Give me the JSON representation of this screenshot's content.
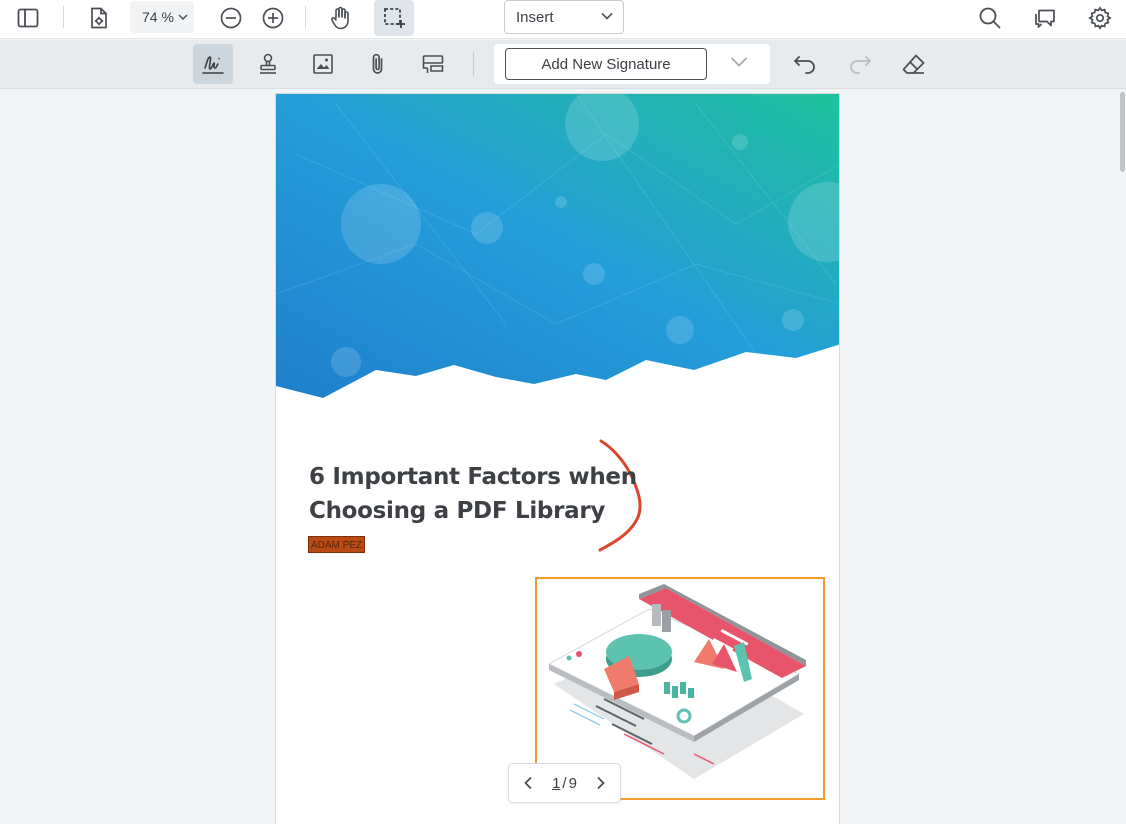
{
  "toolbar": {
    "zoom_level": "74 %",
    "mode": "Insert"
  },
  "signature_bar": {
    "add_signature_label": "Add New Signature"
  },
  "document": {
    "title_line1": "6 Important Factors when",
    "title_line2": "Choosing a PDF Library",
    "author": "ADAM PEZ"
  },
  "pagination": {
    "current_page": "1",
    "separator": "/",
    "total_pages": "9"
  },
  "colors": {
    "accent": "#f39a2c",
    "ink_annotation": "#d9462c",
    "author_highlight": "#b84a12",
    "hero_blue": "#1f86cf",
    "hero_teal": "#1fbf9e"
  }
}
